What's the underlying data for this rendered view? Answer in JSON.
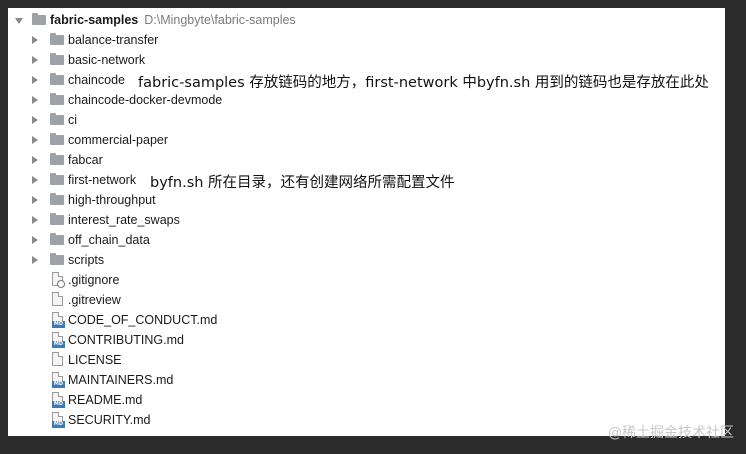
{
  "tree": {
    "root": {
      "name": "fabric-samples",
      "path": "D:\\Mingbyte\\fabric-samples"
    },
    "folders": [
      "balance-transfer",
      "basic-network",
      "chaincode",
      "chaincode-docker-devmode",
      "ci",
      "commercial-paper",
      "fabcar",
      "first-network",
      "high-throughput",
      "interest_rate_swaps",
      "off_chain_data",
      "scripts"
    ],
    "files": [
      {
        "name": ".gitignore",
        "icon": "gitignore-file-icon"
      },
      {
        "name": ".gitreview",
        "icon": "text-file-icon"
      },
      {
        "name": "CODE_OF_CONDUCT.md",
        "icon": "markdown-file-icon"
      },
      {
        "name": "CONTRIBUTING.md",
        "icon": "markdown-file-icon"
      },
      {
        "name": "LICENSE",
        "icon": "text-file-icon"
      },
      {
        "name": "MAINTAINERS.md",
        "icon": "markdown-file-icon"
      },
      {
        "name": "README.md",
        "icon": "markdown-file-icon"
      },
      {
        "name": "SECURITY.md",
        "icon": "markdown-file-icon"
      }
    ],
    "md_badge": "MD"
  },
  "annotations": {
    "chaincode_note": "fabric-samples 存放链码的地方，first-network 中byfn.sh 用到的链码也是存放在此处",
    "first_network_note": "byfn.sh 所在目录，还有创建网络所需配置文件"
  },
  "watermark": "@稀土掘金技术社区"
}
